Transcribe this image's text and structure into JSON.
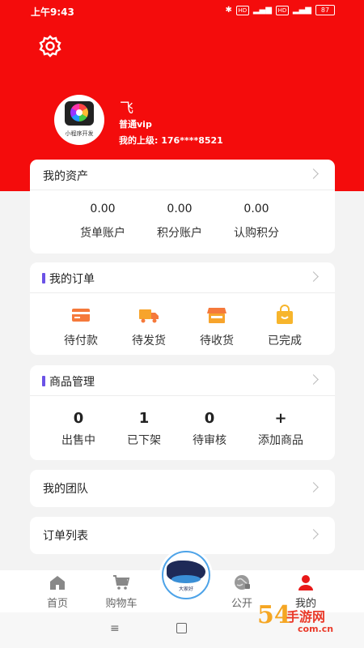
{
  "status_bar": {
    "time": "上午9:43",
    "signal1": "HD",
    "signal2": "HD",
    "battery": "87"
  },
  "profile": {
    "avatar_caption": "小程序开发",
    "name": "飞",
    "level": "普通vip",
    "superior": "我的上级: 176****8521"
  },
  "assets": {
    "title": "我的资产",
    "items": [
      {
        "value": "0.00",
        "label": "货单账户"
      },
      {
        "value": "0.00",
        "label": "积分账户"
      },
      {
        "value": "0.00",
        "label": "认购积分"
      }
    ]
  },
  "orders": {
    "title": "我的订单",
    "items": [
      {
        "label": "待付款",
        "icon": "card-icon"
      },
      {
        "label": "待发货",
        "icon": "truck-icon"
      },
      {
        "label": "待收货",
        "icon": "store-icon"
      },
      {
        "label": "已完成",
        "icon": "bag-icon"
      }
    ]
  },
  "goods": {
    "title": "商品管理",
    "items": [
      {
        "value": "0",
        "label": "出售中"
      },
      {
        "value": "1",
        "label": "已下架"
      },
      {
        "value": "0",
        "label": "待审核"
      },
      {
        "value": "+",
        "label": "添加商品"
      }
    ]
  },
  "team": {
    "title": "我的团队"
  },
  "order_list": {
    "title": "订单列表"
  },
  "tabbar": {
    "items": [
      {
        "label": "首页",
        "icon": "home-icon"
      },
      {
        "label": "购物车",
        "icon": "cart-icon"
      },
      {
        "label": "公开",
        "icon": "globe-icon"
      },
      {
        "label": "我的",
        "icon": "user-icon"
      }
    ],
    "center_logo_text": "大家好"
  },
  "watermark": {
    "digits": "54",
    "brand": "手游网",
    "domain": "com.cn"
  },
  "colors": {
    "primary": "#f40c0c",
    "accent_bar": "#6b52e6",
    "icon_orange": "#f5793b",
    "icon_yellow": "#f7b52c"
  }
}
